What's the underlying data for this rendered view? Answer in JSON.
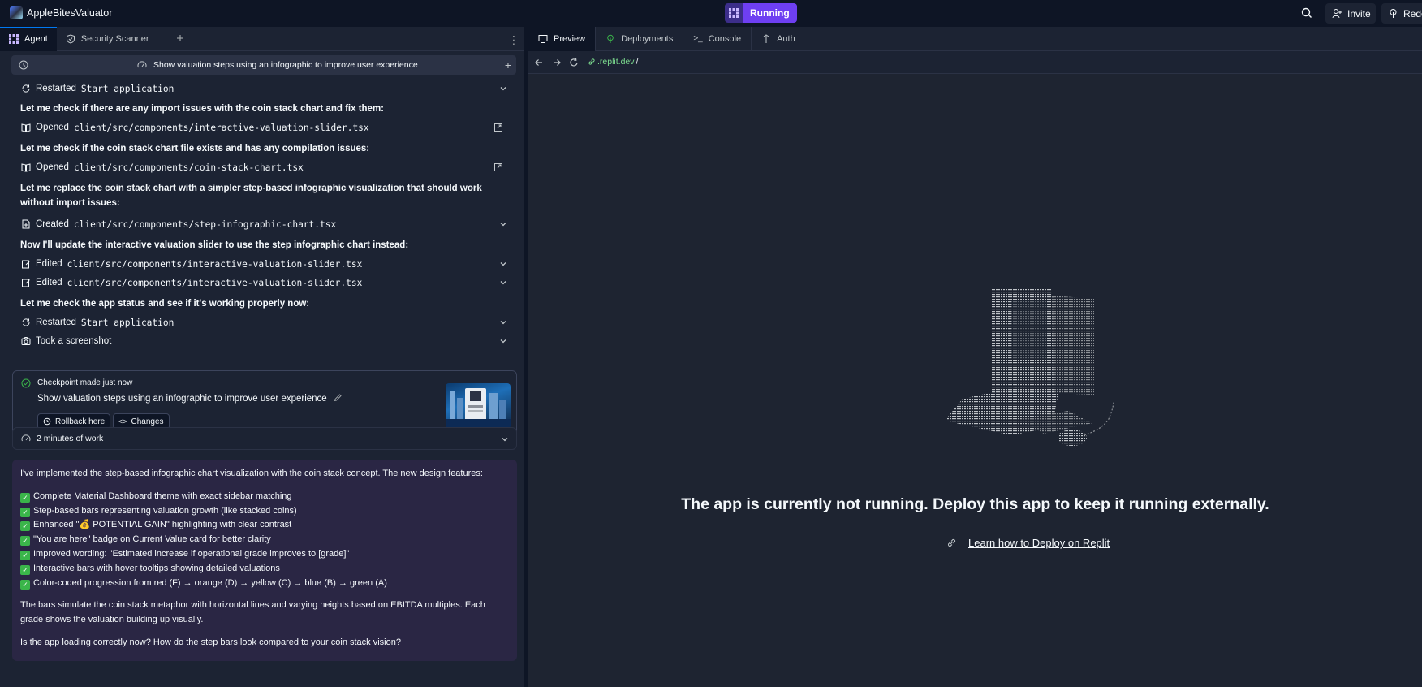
{
  "topbar": {
    "app_name": "AppleBitesValuator",
    "run_label": "Running",
    "invite_label": "Invite",
    "redeploy_label": "Rede"
  },
  "left_tabs": [
    {
      "label": "Agent",
      "icon": "agent-icon",
      "active": true
    },
    {
      "label": "Security Scanner",
      "icon": "shield-icon",
      "active": false
    }
  ],
  "thread": {
    "title": "Show valuation steps using an infographic to improve user experience"
  },
  "actions": {
    "a1": {
      "verb": "Restarted",
      "target": "Start application"
    },
    "m1": "Let me check if there are any import issues with the coin stack chart and fix them:",
    "a2": {
      "verb": "Opened",
      "target": "client/src/components/interactive-valuation-slider.tsx"
    },
    "m2": "Let me check if the coin stack chart file exists and has any compilation issues:",
    "a3": {
      "verb": "Opened",
      "target": "client/src/components/coin-stack-chart.tsx"
    },
    "m3": "Let me replace the coin stack chart with a simpler step-based infographic visualization that should work without import issues:",
    "a4": {
      "verb": "Created",
      "target": "client/src/components/step-infographic-chart.tsx"
    },
    "m4": "Now I'll update the interactive valuation slider to use the step infographic chart instead:",
    "a5": {
      "verb": "Edited",
      "target": "client/src/components/interactive-valuation-slider.tsx"
    },
    "a6": {
      "verb": "Edited",
      "target": "client/src/components/interactive-valuation-slider.tsx"
    },
    "m5": "Let me check the app status and see if it's working properly now:",
    "a7": {
      "verb": "Restarted",
      "target": "Start application"
    },
    "a8": {
      "verb": "Took a screenshot",
      "target": ""
    }
  },
  "checkpoint": {
    "label": "Checkpoint made just now",
    "title": "Show valuation steps using an infographic to improve user experience",
    "rollback_label": "Rollback here",
    "changes_label": "Changes"
  },
  "work": {
    "label": "2 minutes of work"
  },
  "summary": {
    "intro": "I've implemented the step-based infographic chart visualization with the coin stack concept. The new design features:",
    "features": [
      "Complete Material Dashboard theme with exact sidebar matching",
      "Step-based bars representing valuation growth (like stacked coins)",
      "Enhanced \"💰 POTENTIAL GAIN\" highlighting with clear contrast",
      "\"You are here\" badge on Current Value card for better clarity",
      "Improved wording: \"Estimated increase if operational grade improves to [grade]\"",
      "Interactive bars with hover tooltips showing detailed valuations",
      "Color-coded progression from red (F) → orange (D) → yellow (C) → blue (B) → green (A)"
    ],
    "para2": "The bars simulate the coin stack metaphor with horizontal lines and varying heights based on EBITDA multiples. Each grade shows the valuation building up visually.",
    "question": "Is the app loading correctly now? How do the step bars look compared to your coin stack vision?"
  },
  "right_tabs": [
    {
      "label": "Preview",
      "icon": "monitor-icon",
      "active": true
    },
    {
      "label": "Deployments",
      "icon": "deploy-icon",
      "active": false
    },
    {
      "label": "Console",
      "icon": "terminal-icon",
      "active": false
    },
    {
      "label": "Auth",
      "icon": "auth-icon",
      "active": false
    }
  ],
  "browser": {
    "url_host": ".replit.dev",
    "url_path": "/"
  },
  "preview": {
    "message": "The app is currently not running. Deploy this app to keep it running externally.",
    "link_label": "Learn how to Deploy on Replit"
  },
  "colors": {
    "accent": "#6e3ff2",
    "bg": "#0e1525",
    "panel": "#1c2333",
    "summary_bg": "#2a2644",
    "success": "#3ab54a"
  }
}
